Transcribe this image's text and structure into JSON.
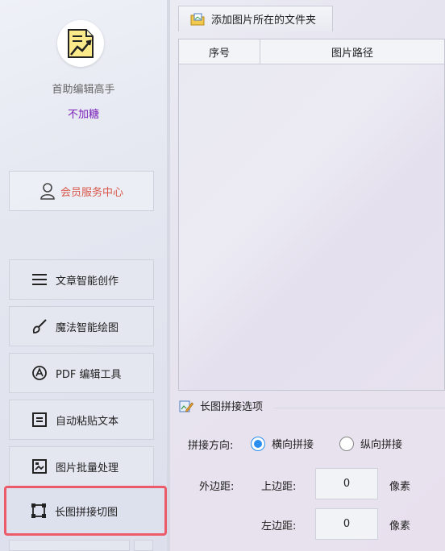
{
  "sidebar": {
    "app_name": "首助编辑高手",
    "app_subtitle": "不加糖",
    "member_center": {
      "label": "会员服务中心",
      "icon": "user-icon"
    },
    "items": [
      {
        "label": "文章智能创作",
        "icon": "list-icon",
        "active": false
      },
      {
        "label": "魔法智能绘图",
        "icon": "brush-icon",
        "active": false
      },
      {
        "label": "PDF 编辑工具",
        "icon": "pdf-icon",
        "active": false
      },
      {
        "label": "自动粘贴文本",
        "icon": "paste-icon",
        "active": false
      },
      {
        "label": "图片批量处理",
        "icon": "image-icon",
        "active": false
      },
      {
        "label": "长图拼接切图",
        "icon": "crop-icon",
        "active": true
      }
    ]
  },
  "toolbar": {
    "add_folder_label": "添加图片所在的文件夹",
    "add_folder_icon": "folder-image-icon"
  },
  "table": {
    "columns": [
      "序号",
      "图片路径"
    ],
    "rows": []
  },
  "options": {
    "title": "长图拼接选项",
    "direction_label": "拼接方向:",
    "direction_options": [
      {
        "label": "横向拼接",
        "selected": true
      },
      {
        "label": "纵向拼接",
        "selected": false
      }
    ],
    "outer_margin_label": "外边距:",
    "top_margin_label": "上边距:",
    "top_margin_value": "0",
    "left_margin_label": "左边距:",
    "left_margin_value": "0",
    "unit": "像素"
  },
  "colors": {
    "accent": "#2b8ff0",
    "active_border": "#ec5b69",
    "subtitle": "#7a1fb8",
    "member_text": "#d9574a"
  }
}
